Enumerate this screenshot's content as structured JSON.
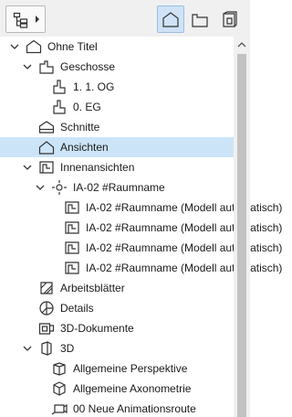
{
  "toolbar": {
    "dropdown_icon": "project-map-icon",
    "views": [
      {
        "name": "project-map-view",
        "active": true
      },
      {
        "name": "view-map-view",
        "active": false
      },
      {
        "name": "layout-book-view",
        "active": false
      }
    ]
  },
  "tree": {
    "items": [
      {
        "label": "Ohne Titel",
        "icon": "project-icon",
        "expanded": true
      },
      {
        "label": "Geschosse",
        "icon": "stories-icon",
        "expanded": true
      },
      {
        "label": "1. 1. OG",
        "icon": "story-icon"
      },
      {
        "label": "0. EG",
        "icon": "story-icon"
      },
      {
        "label": "Schnitte",
        "icon": "sections-icon"
      },
      {
        "label": "Ansichten",
        "icon": "elevations-icon",
        "selected": true
      },
      {
        "label": "Innenansichten",
        "icon": "interior-elevations-icon",
        "expanded": true
      },
      {
        "label": "IA-02 #Raumname",
        "icon": "interior-marker-icon",
        "expanded": true
      },
      {
        "label": "IA-02 #Raumname (Modell automatisch)",
        "icon": "interior-view-icon"
      },
      {
        "label": "IA-02 #Raumname (Modell automatisch)",
        "icon": "interior-view-icon"
      },
      {
        "label": "IA-02 #Raumname (Modell automatisch)",
        "icon": "interior-view-icon"
      },
      {
        "label": "IA-02 #Raumname (Modell automatisch)",
        "icon": "interior-view-icon"
      },
      {
        "label": "Arbeitsblätter",
        "icon": "worksheets-icon"
      },
      {
        "label": "Details",
        "icon": "details-icon"
      },
      {
        "label": "3D-Dokumente",
        "icon": "3d-documents-icon"
      },
      {
        "label": "3D",
        "icon": "3d-icon",
        "expanded": true
      },
      {
        "label": "Allgemeine Perspektive",
        "icon": "perspective-icon"
      },
      {
        "label": "Allgemeine Axonometrie",
        "icon": "axonometry-icon"
      },
      {
        "label": "00 Neue Animationsroute",
        "icon": "camera-path-icon"
      }
    ]
  },
  "colors": {
    "selection": "#cce4f7",
    "active_button": "#cfe2f6",
    "toolbar_bg": "#f0f0f0",
    "scroll_thumb": "#c2c2c2"
  }
}
